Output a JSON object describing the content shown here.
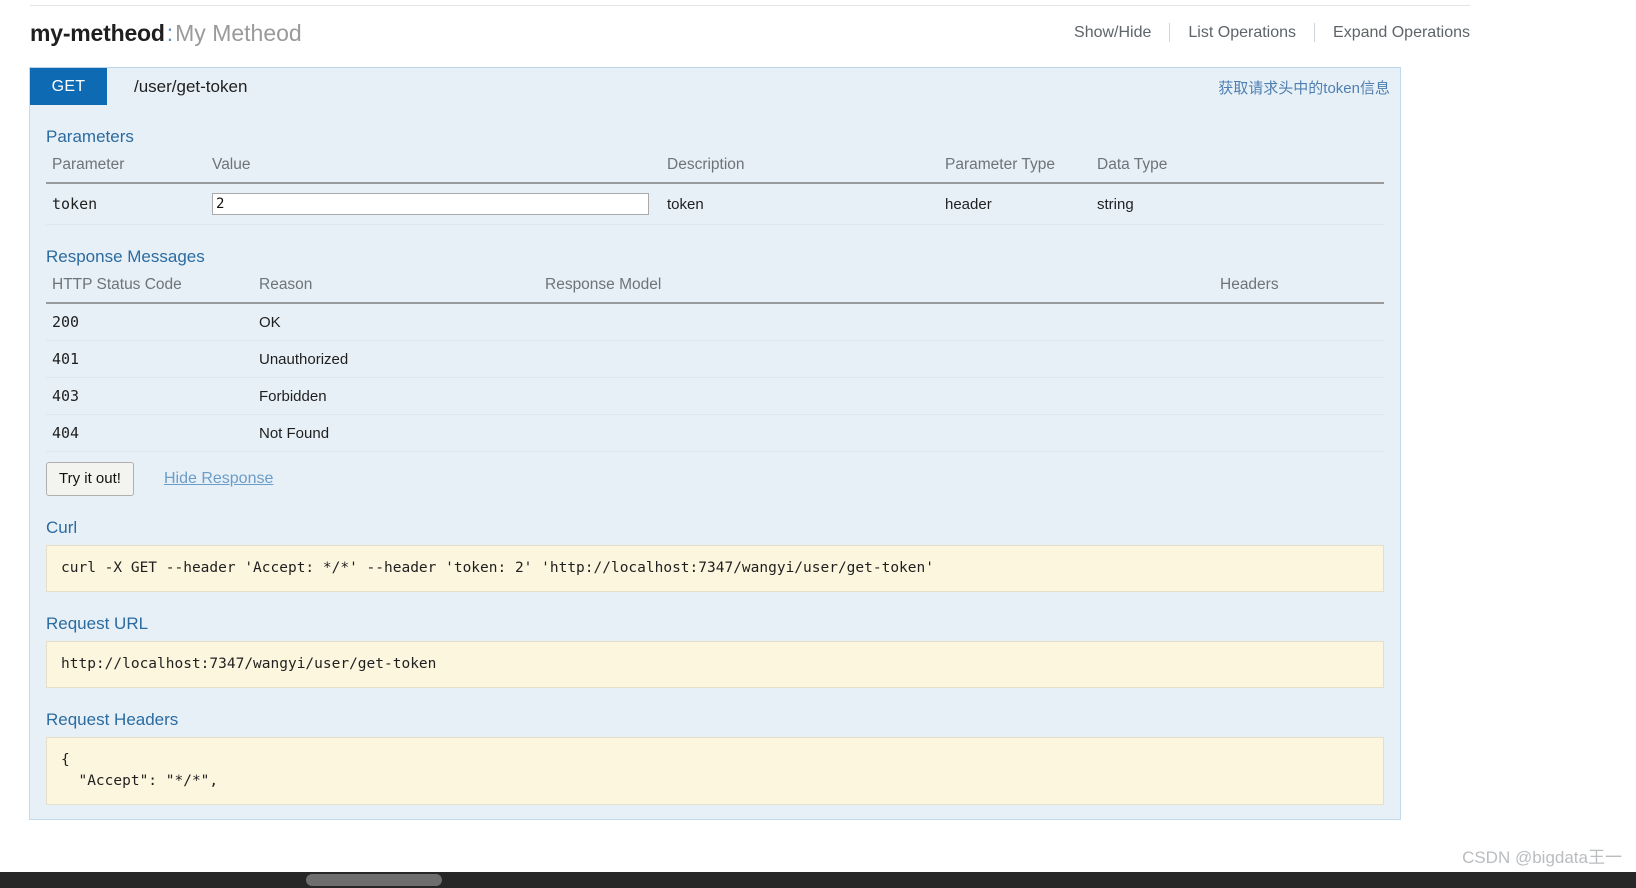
{
  "resource": {
    "name": "my-metheod",
    "separator": ":",
    "description": "My Metheod",
    "options": [
      {
        "label": "Show/Hide"
      },
      {
        "label": "List Operations"
      },
      {
        "label": "Expand Operations"
      }
    ]
  },
  "operation": {
    "method": "GET",
    "path": "/user/get-token",
    "summary": "获取请求头中的token信息",
    "method_color": "#0f6ab4"
  },
  "parameters": {
    "title": "Parameters",
    "columns": [
      "Parameter",
      "Value",
      "Description",
      "Parameter Type",
      "Data Type"
    ],
    "rows": [
      {
        "parameter": "token",
        "value": "2",
        "placeholder": "",
        "description": "token",
        "parameter_type": "header",
        "data_type": "string"
      }
    ]
  },
  "response_messages": {
    "title": "Response Messages",
    "columns": [
      "HTTP Status Code",
      "Reason",
      "Response Model",
      "Headers"
    ],
    "rows": [
      {
        "code": "200",
        "reason": "OK",
        "model": "",
        "headers": ""
      },
      {
        "code": "401",
        "reason": "Unauthorized",
        "model": "",
        "headers": ""
      },
      {
        "code": "403",
        "reason": "Forbidden",
        "model": "",
        "headers": ""
      },
      {
        "code": "404",
        "reason": "Not Found",
        "model": "",
        "headers": ""
      }
    ]
  },
  "actions": {
    "try_it_out": "Try it out!",
    "hide_response": "Hide Response"
  },
  "curl": {
    "title": "Curl",
    "command": "curl -X GET --header 'Accept: */*' --header 'token: 2' 'http://localhost:7347/wangyi/user/get-token'"
  },
  "request_url": {
    "title": "Request URL",
    "url": "http://localhost:7347/wangyi/user/get-token"
  },
  "request_headers": {
    "title": "Request Headers",
    "body": "{\n  \"Accept\": \"*/*\","
  },
  "watermark": "CSDN @bigdata王一"
}
